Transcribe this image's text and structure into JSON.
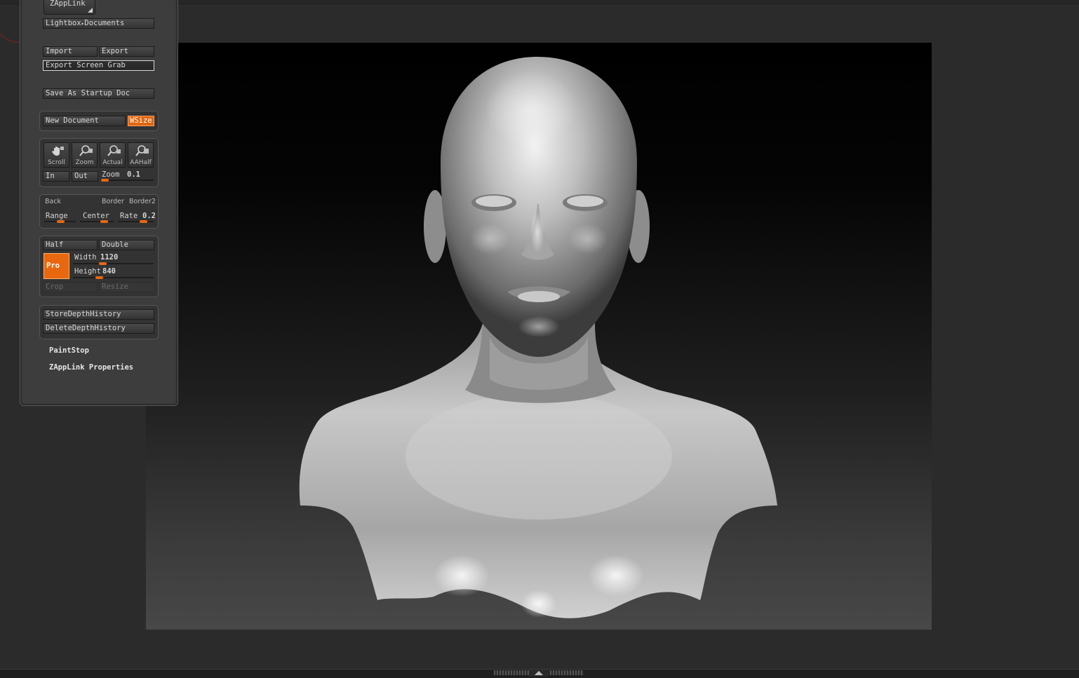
{
  "panel": {
    "zapplink": "ZAppLink",
    "lightbox": "Lightbox",
    "lightbox_arrow": "▸",
    "documents": "Documents",
    "import": "Import",
    "export": "Export",
    "export_screen_grab": "Export Screen Grab",
    "save_startup": "Save As Startup Doc",
    "new_document": "New Document",
    "wsize": "WSize",
    "scroll": "Scroll",
    "zoom": "Zoom",
    "actual": "Actual",
    "aahalf": "AAHalf",
    "in": "In",
    "out": "Out",
    "zoom_label": "Zoom",
    "zoom_value": "0.1",
    "back": "Back",
    "border": "Border",
    "border2": "Border2",
    "range": "Range",
    "center": "Center",
    "rate": "Rate",
    "rate_value": "0.2",
    "half": "Half",
    "double": "Double",
    "pro": "Pro",
    "width_label": "Width",
    "width_value": "1120",
    "height_label": "Height",
    "height_value": "840",
    "crop": "Crop",
    "resize": "Resize",
    "store_depth": "StoreDepthHistory",
    "delete_depth": "DeleteDepthHistory",
    "paintstop": "PaintStop",
    "zapplink_properties": "ZAppLink Properties"
  },
  "bottom": {
    "arrows": "◢◣"
  },
  "colors": {
    "accent": "#e8680f",
    "panel_bg": "#3d3d3d",
    "app_bg": "#2b2b2b"
  },
  "icons": [
    "hand-icon",
    "zoom-magnifier-icon",
    "actual-magnifier-icon",
    "aahalf-magnifier-icon",
    "dropdown-triangle-icon"
  ]
}
